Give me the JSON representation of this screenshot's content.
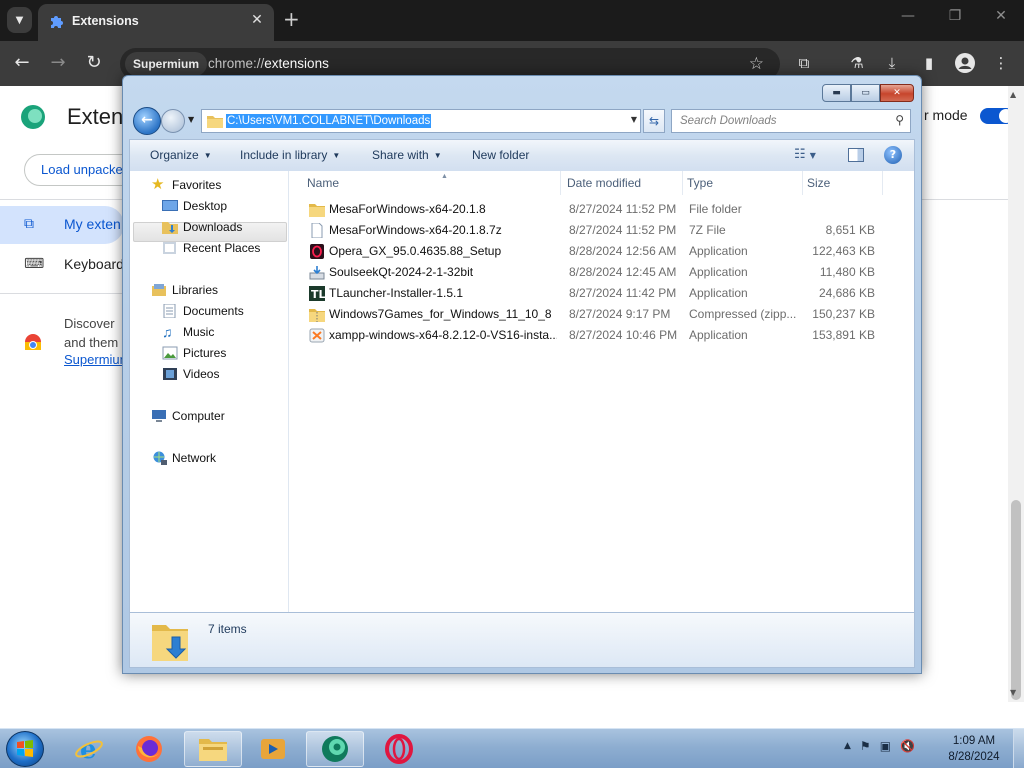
{
  "browser": {
    "tab_title": "Extensions",
    "omnibox_chip": "Supermium",
    "url_scheme": "chrome://",
    "url_host": "extensions"
  },
  "ext_page": {
    "title": "Extens",
    "dev_mode_label": "r mode",
    "dev_mode_on": true,
    "load_unpacked": "Load unpacke",
    "sidebar": [
      {
        "label": "My exten",
        "active": true
      },
      {
        "label": "Keyboard",
        "active": false
      }
    ],
    "discover_text": "Discover\nand them",
    "discover_link": "Supermium"
  },
  "dialog": {
    "address_path": "C:\\Users\\VM1.COLLABNET\\Downloads",
    "search_placeholder": "Search Downloads",
    "commands": {
      "organize": "Organize",
      "include_in_library": "Include in library",
      "share_with": "Share with",
      "new_folder": "New folder"
    },
    "nav": {
      "favorites": "Favorites",
      "desktop": "Desktop",
      "downloads": "Downloads",
      "recent_places": "Recent Places",
      "libraries": "Libraries",
      "documents": "Documents",
      "music": "Music",
      "pictures": "Pictures",
      "videos": "Videos",
      "computer": "Computer",
      "network": "Network"
    },
    "columns": {
      "name": "Name",
      "date_modified": "Date modified",
      "type": "Type",
      "size": "Size"
    },
    "files": [
      {
        "name": "MesaForWindows-x64-20.1.8",
        "date": "8/27/2024 11:52 PM",
        "type": "File folder",
        "size": "",
        "icon": "folder-icon"
      },
      {
        "name": "MesaForWindows-x64-20.1.8.7z",
        "date": "8/27/2024 11:52 PM",
        "type": "7Z File",
        "size": "8,651 KB",
        "icon": "blank-file-icon"
      },
      {
        "name": "Opera_GX_95.0.4635.88_Setup",
        "date": "8/28/2024 12:56 AM",
        "type": "Application",
        "size": "122,463 KB",
        "icon": "opera-gx-icon"
      },
      {
        "name": "SoulseekQt-2024-2-1-32bit",
        "date": "8/28/2024 12:45 AM",
        "type": "Application",
        "size": "11,480 KB",
        "icon": "installer-icon"
      },
      {
        "name": "TLauncher-Installer-1.5.1",
        "date": "8/27/2024 11:42 PM",
        "type": "Application",
        "size": "24,686 KB",
        "icon": "tlauncher-icon"
      },
      {
        "name": "Windows7Games_for_Windows_11_10_8",
        "date": "8/27/2024 9:17 PM",
        "type": "Compressed (zipp...",
        "size": "150,237 KB",
        "icon": "zip-folder-icon"
      },
      {
        "name": "xampp-windows-x64-8.2.12-0-VS16-insta...",
        "date": "8/27/2024 10:46 PM",
        "type": "Application",
        "size": "153,891 KB",
        "icon": "xampp-icon"
      }
    ],
    "item_count": "7 items"
  },
  "taskbar": {
    "clock_time": "1:09 AM",
    "clock_date": "8/28/2024"
  }
}
